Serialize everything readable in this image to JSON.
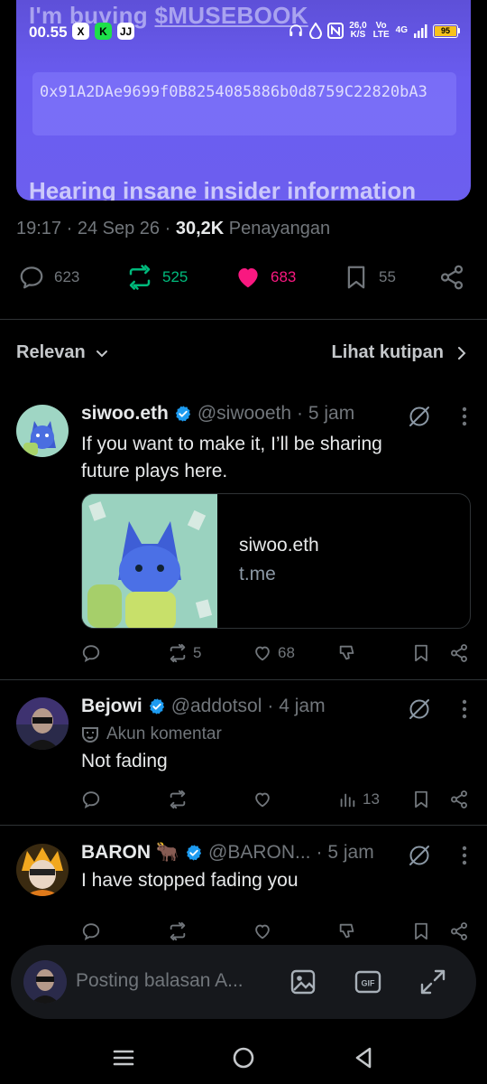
{
  "status_bar": {
    "time": "00.55",
    "apps": [
      "X",
      "K",
      "JJ"
    ],
    "speed_value": "26,0",
    "speed_unit": "K/S",
    "volte": "Vo LTE",
    "network": "4G",
    "battery": "95"
  },
  "embed": {
    "heading_prefix": "I'm buying ",
    "heading_ticker": "$MUSEBOOK",
    "address": "0x91A2DAe9699f0B8254085886b0d8759C22820bA3",
    "bottom_text": "Hearing insane insider information"
  },
  "post_meta": {
    "time": "19:17",
    "date": "24 Sep 26",
    "views_count": "30,2K",
    "views_label": "Penayangan"
  },
  "post_actions": {
    "replies": "623",
    "reposts": "525",
    "likes": "683",
    "bookmarks": "55"
  },
  "sort": {
    "left_label": "Relevan",
    "right_label": "Lihat kutipan"
  },
  "replies": [
    {
      "name": "siwoo.eth",
      "handle": "@siwooeth",
      "time": "· 5 jam",
      "text_line1": "If you want to make it, I’ll be sharing",
      "text_line2": "future plays here.",
      "card_title": "siwoo.eth",
      "card_domain": "t.me",
      "reposts": "5",
      "likes": "68"
    },
    {
      "name": "Bejowi",
      "handle": "@addotsol",
      "time": "· 4 jam",
      "sub_label": "Akun komentar",
      "text": "Not fading",
      "views": "13"
    },
    {
      "name": "BARON",
      "name_emoji": "🐂",
      "handle": "@BARON...",
      "time": "· 5 jam",
      "text": "I have stopped fading you"
    }
  ],
  "compose": {
    "placeholder": "Posting balasan A..."
  },
  "colors": {
    "accent_blue": "#1d9bf0",
    "repost_green": "#00ba7c",
    "like_pink": "#f91880",
    "muted": "#71767b"
  }
}
